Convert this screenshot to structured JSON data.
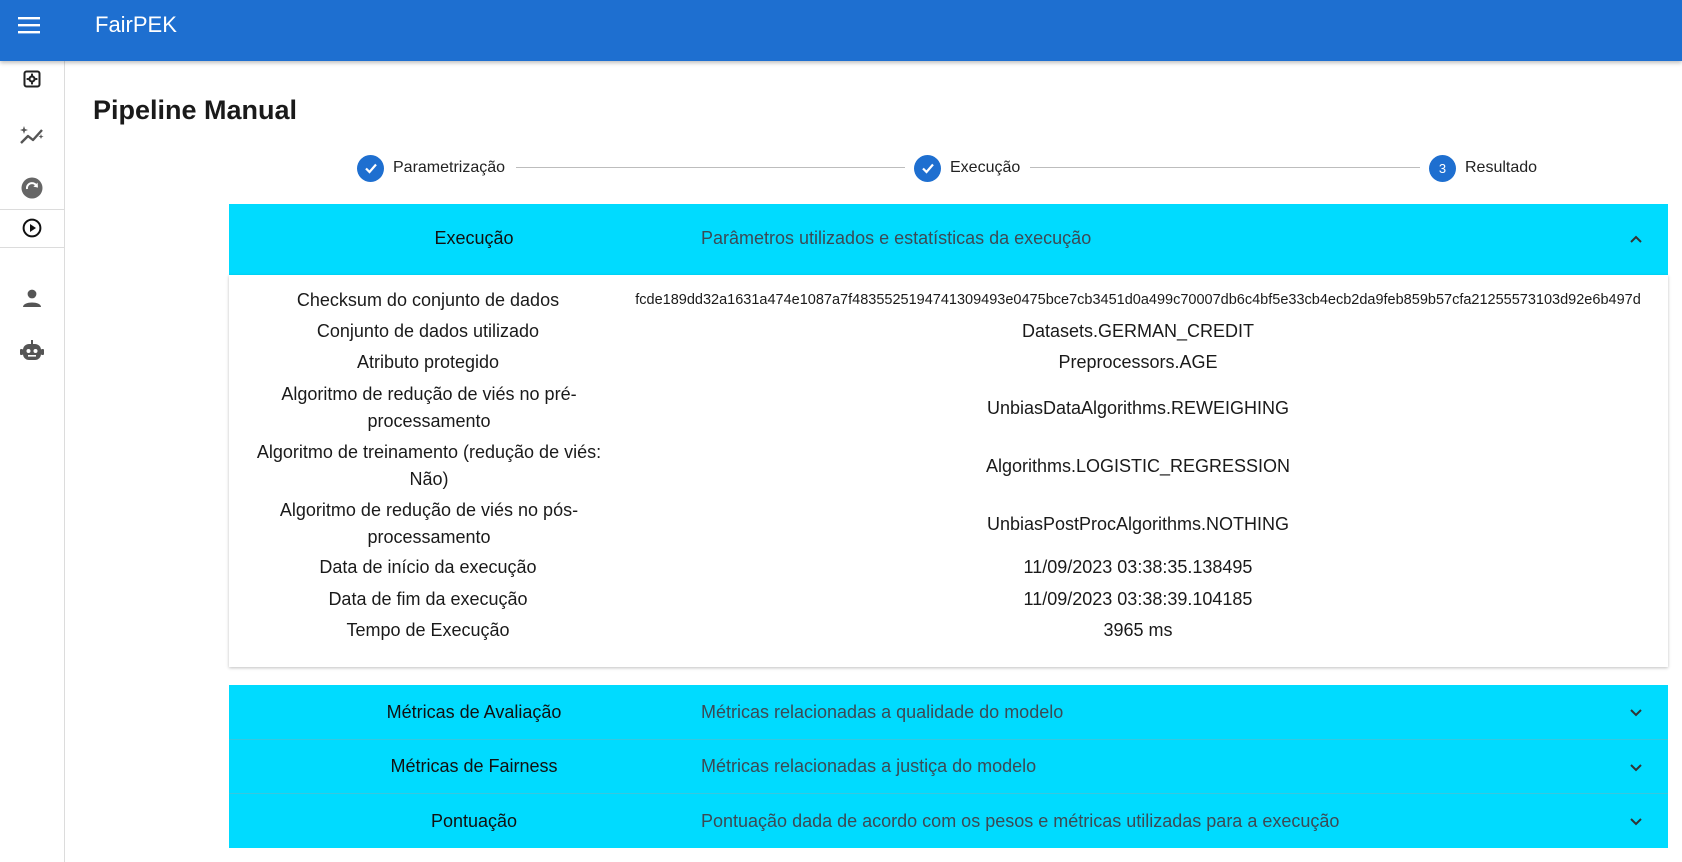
{
  "app": {
    "title": "FairPEK"
  },
  "colors": {
    "appbar": "#1e6fd0",
    "panel_header": "#00dbff",
    "step_active": "#1e6fd0"
  },
  "sidebar": {
    "items": [
      {
        "icon": "settings-box-icon"
      },
      {
        "icon": "chart-sparkle-icon"
      },
      {
        "icon": "refresh-circle-icon"
      },
      {
        "icon": "play-circle-icon"
      },
      {
        "icon": "person-icon"
      },
      {
        "icon": "robot-icon"
      }
    ]
  },
  "page": {
    "title": "Pipeline Manual"
  },
  "stepper": {
    "steps": [
      {
        "label": "Parametrização",
        "state": "done"
      },
      {
        "label": "Execução",
        "state": "done"
      },
      {
        "label": "Resultado",
        "state": "active",
        "number": "3"
      }
    ]
  },
  "panels": {
    "execucao": {
      "title": "Execução",
      "description": "Parâmetros utilizados e estatísticas da execução",
      "expanded": true,
      "rows": [
        {
          "label": "Checksum do conjunto de dados",
          "value": "fcde189dd32a1631a474e1087a7f4835525194741309493e0475bce7cb3451d0a499c70007db6c4bf5e33cb4ecb2da9feb859b57cfa21255573103d92e6b497d"
        },
        {
          "label": "Conjunto de dados utilizado",
          "value": "Datasets.GERMAN_CREDIT"
        },
        {
          "label": "Atributo protegido",
          "value": "Preprocessors.AGE"
        },
        {
          "label": "Algoritmo de redução de viés no pré-processamento",
          "value": "UnbiasDataAlgorithms.REWEIGHING"
        },
        {
          "label": "Algoritmo de treinamento (redução de viés: Não)",
          "value": "Algorithms.LOGISTIC_REGRESSION"
        },
        {
          "label": "Algoritmo de redução de viés no pós-processamento",
          "value": "UnbiasPostProcAlgorithms.NOTHING"
        },
        {
          "label": "Data de início da execução",
          "value": "11/09/2023 03:38:35.138495"
        },
        {
          "label": "Data de fim da execução",
          "value": "11/09/2023 03:38:39.104185"
        },
        {
          "label": "Tempo de Execução",
          "value": "3965 ms"
        }
      ]
    },
    "metricas_avaliacao": {
      "title": "Métricas de Avaliação",
      "description": "Métricas relacionadas a qualidade do modelo",
      "expanded": false
    },
    "metricas_fairness": {
      "title": "Métricas de Fairness",
      "description": "Métricas relacionadas a justiça do modelo",
      "expanded": false
    },
    "pontuacao": {
      "title": "Pontuação",
      "description": "Pontuação dada de acordo com os pesos e métricas utilizadas para a execução",
      "expanded": false
    }
  }
}
